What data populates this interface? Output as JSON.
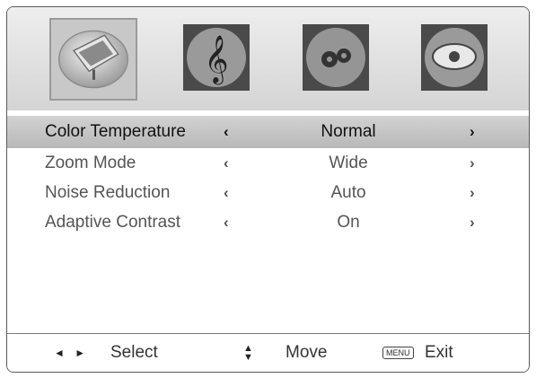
{
  "tabs": [
    {
      "icon": "picture-icon",
      "selected": true
    },
    {
      "icon": "sound-icon",
      "selected": false
    },
    {
      "icon": "setup-icon",
      "selected": false
    },
    {
      "icon": "feature-icon",
      "selected": false
    }
  ],
  "settings": [
    {
      "label": "Color Temperature",
      "value": "Normal",
      "left_arrow": "‹",
      "right_arrow": "›",
      "selected": true
    },
    {
      "label": "Zoom Mode",
      "value": "Wide",
      "left_arrow": "‹",
      "right_arrow": "›",
      "selected": false
    },
    {
      "label": "Noise Reduction",
      "value": "Auto",
      "left_arrow": "‹",
      "right_arrow": "›",
      "selected": false
    },
    {
      "label": "Adaptive Contrast",
      "value": "On",
      "left_arrow": "‹",
      "right_arrow": "›",
      "selected": false
    }
  ],
  "footer": {
    "lr_arrows": "◄ ►",
    "select_label": "Select",
    "move_label": "Move",
    "menu_key": "MENU",
    "exit_label": "Exit"
  }
}
